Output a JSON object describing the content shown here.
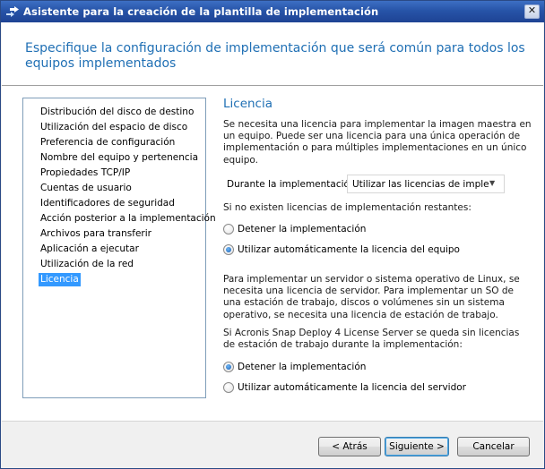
{
  "window": {
    "title": "Asistente para la creación de la plantilla de implementación",
    "close_glyph": "✕"
  },
  "header": {
    "title": "Especifique la configuración de implementación que será común para todos los equipos implementados"
  },
  "steps": [
    {
      "label": "Distribución del disco de destino",
      "selected": false
    },
    {
      "label": "Utilización del espacio de disco",
      "selected": false
    },
    {
      "label": "Preferencia de configuración",
      "selected": false
    },
    {
      "label": "Nombre del equipo y pertenencia",
      "selected": false
    },
    {
      "label": "Propiedades TCP/IP",
      "selected": false
    },
    {
      "label": "Cuentas de usuario",
      "selected": false
    },
    {
      "label": "Identificadores de seguridad",
      "selected": false
    },
    {
      "label": "Acción posterior a la implementación",
      "selected": false
    },
    {
      "label": "Archivos para transferir",
      "selected": false
    },
    {
      "label": "Aplicación a ejecutar",
      "selected": false
    },
    {
      "label": "Utilización de la red",
      "selected": false
    },
    {
      "label": "Licencia",
      "selected": true
    }
  ],
  "license": {
    "section_title": "Licencia",
    "intro": "Se necesita una licencia para implementar la imagen maestra en un equipo. Puede ser una licencia para una única operación de implementación o para múltiples implementaciones en un único equipo.",
    "during_label": "Durante la implementación:",
    "during_value": "Utilizar las licencias de implementación",
    "no_licenses_label": "Si no existen licencias de implementación restantes:",
    "option_stop": "Detener la implementación",
    "option_use_machine": "Utilizar automáticamente la licencia del equipo",
    "no_licenses_selected": "use_machine",
    "server_para": "Para implementar un servidor o sistema operativo de Linux, se necesita una licencia de servidor. Para implementar un SO de una estación de trabajo, discos o volúmenes sin un sistema operativo, se necesita una licencia de estación de trabajo.",
    "server_question": "Si Acronis Snap Deploy 4 License Server se queda sin licencias de estación de trabajo durante la implementación:",
    "option_stop_2": "Detener la implementación",
    "option_use_server": "Utilizar automáticamente la licencia del servidor",
    "server_selected": "stop"
  },
  "footer": {
    "back_label": "< Atrás",
    "next_label": "Siguiente >",
    "cancel_label": "Cancelar"
  },
  "colors": {
    "accent": "#1f6fb4",
    "selection": "#3399ff",
    "titlebar": "#2754a8"
  }
}
